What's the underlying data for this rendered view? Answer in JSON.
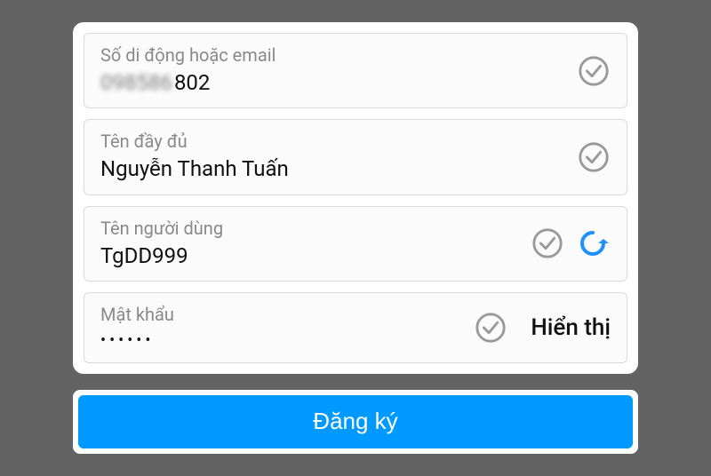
{
  "fields": {
    "phoneEmail": {
      "label": "Số di động hoặc email",
      "value_obscured": "098586",
      "value_clear": "802"
    },
    "fullName": {
      "label": "Tên đầy đủ",
      "value": "Nguyễn Thanh Tuấn"
    },
    "username": {
      "label": "Tên người dùng",
      "value": "TgDD999"
    },
    "password": {
      "label": "Mật khẩu",
      "value_masked": "••••••",
      "show_toggle": "Hiển thị"
    }
  },
  "signup_button": "Đăng ký"
}
